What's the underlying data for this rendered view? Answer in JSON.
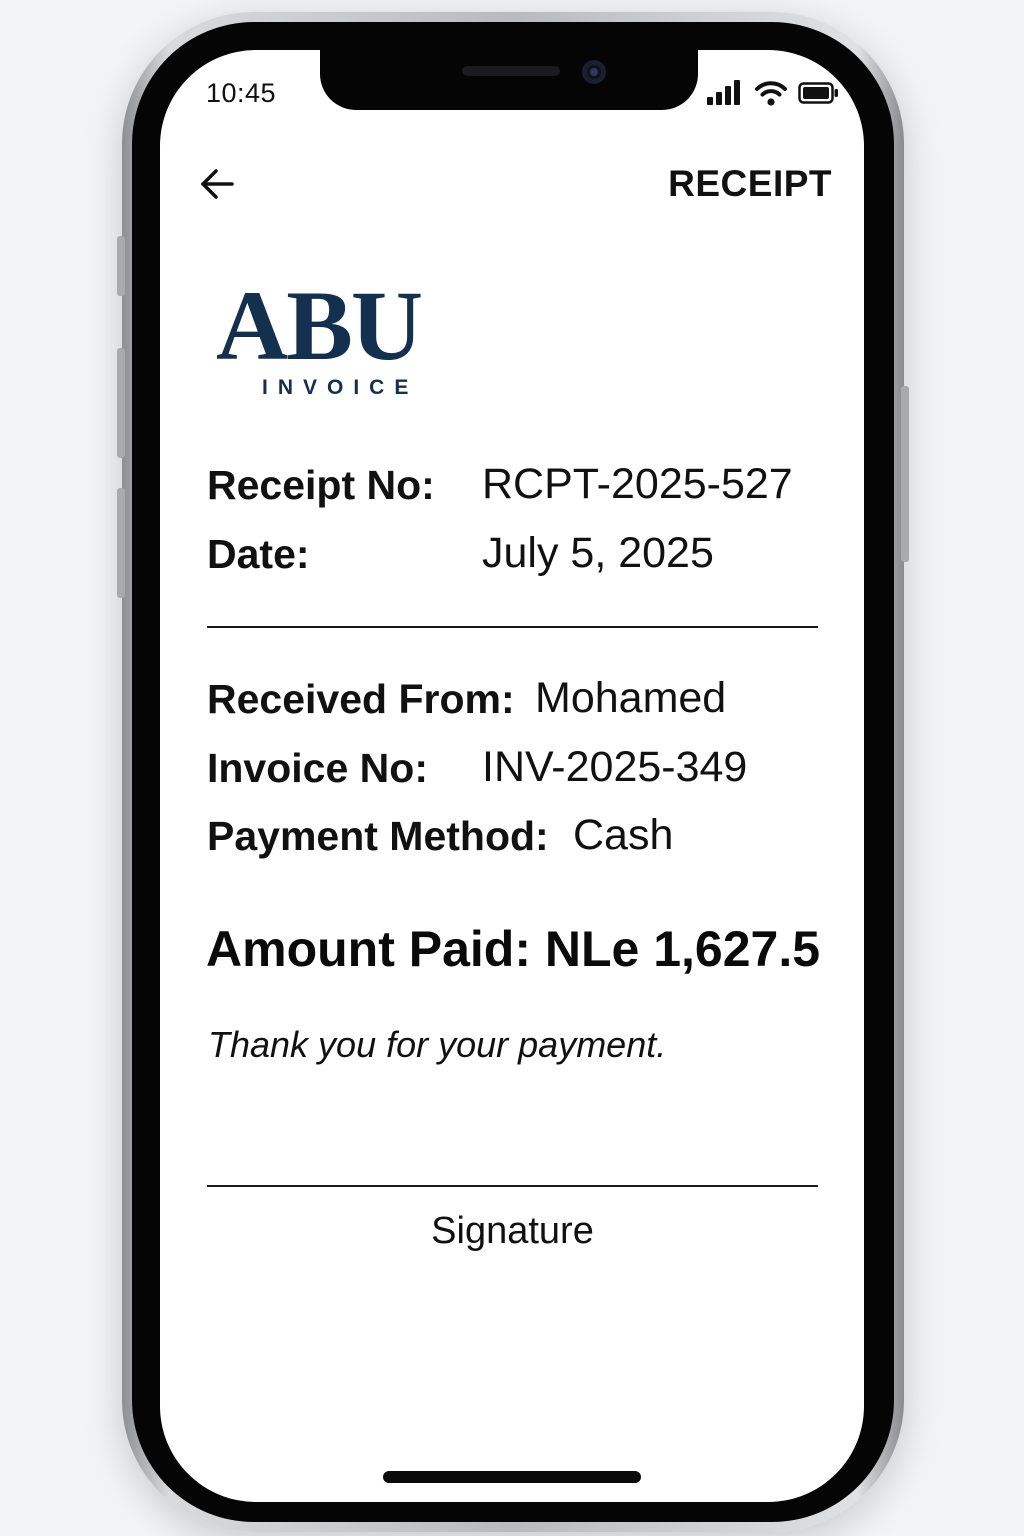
{
  "status_bar": {
    "time": "10:45",
    "icons": [
      "signal-icon",
      "wifi-icon",
      "battery-icon"
    ]
  },
  "header": {
    "back_icon": "arrow-left-icon",
    "title": "RECEIPT"
  },
  "logo": {
    "mark": "ABU",
    "subtitle": "INVOICE",
    "color": "#14304f"
  },
  "receipt": {
    "receipt_no_label": "Receipt No:",
    "receipt_no_value": "RCPT-2025-527",
    "date_label": "Date:",
    "date_value": "July 5, 2025",
    "received_from_label": "Received From:",
    "received_from_value": "Mohamed",
    "invoice_no_label": "Invoice No:",
    "invoice_no_value": "INV-2025-349",
    "payment_method_label": "Payment Method:",
    "payment_method_value": "Cash",
    "amount_paid": "Amount Paid: NLe 1,627.5",
    "thank_you": "Thank you for your payment.",
    "signature_label": "Signature"
  }
}
